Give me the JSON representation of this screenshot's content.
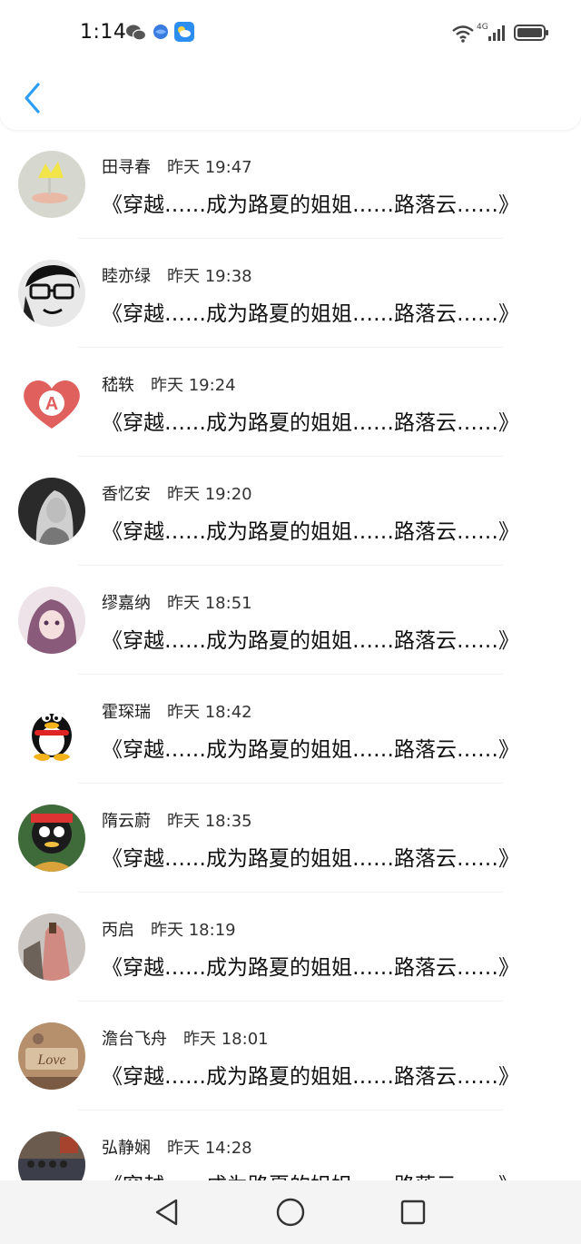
{
  "status_bar": {
    "time": "1:14",
    "network": "4G"
  },
  "header": {
    "back_icon": "chevron-left-icon",
    "accent": "#2a9df4"
  },
  "messages": [
    {
      "name": "田寻春",
      "time": "昨天 19:47",
      "text": "《穿越……成为路夏的姐姐……路落云……》"
    },
    {
      "name": "睦亦绿",
      "time": "昨天 19:38",
      "text": "《穿越……成为路夏的姐姐……路落云……》"
    },
    {
      "name": "嵇轶",
      "time": "昨天 19:24",
      "text": "《穿越……成为路夏的姐姐……路落云……》"
    },
    {
      "name": "香忆安",
      "time": "昨天 19:20",
      "text": "《穿越……成为路夏的姐姐……路落云……》"
    },
    {
      "name": "缪嘉纳",
      "time": "昨天 18:51",
      "text": "《穿越……成为路夏的姐姐……路落云……》"
    },
    {
      "name": "霍琛瑞",
      "time": "昨天 18:42",
      "text": "《穿越……成为路夏的姐姐……路落云……》"
    },
    {
      "name": "隋云蔚",
      "time": "昨天 18:35",
      "text": "《穿越……成为路夏的姐姐……路落云……》"
    },
    {
      "name": "丙启",
      "time": "昨天 18:19",
      "text": "《穿越……成为路夏的姐姐……路落云……》"
    },
    {
      "name": "澹台飞舟",
      "time": "昨天 18:01",
      "text": "《穿越……成为路夏的姐姐……路落云……》"
    },
    {
      "name": "弘静娴",
      "time": "昨天 14:28",
      "text": "《穿越……成为路夏的姐姐……路落云……》"
    }
  ],
  "nav_bar": {
    "back_icon": "triangle-back-icon",
    "home_icon": "circle-home-icon",
    "recents_icon": "square-recents-icon"
  }
}
